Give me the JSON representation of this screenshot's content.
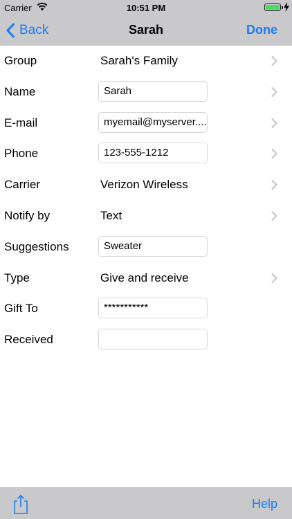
{
  "status_bar": {
    "carrier": "Carrier",
    "time": "10:51 PM"
  },
  "nav": {
    "back_label": "Back",
    "title": "Sarah",
    "done_label": "Done"
  },
  "rows": [
    {
      "label": "Group",
      "value": "Sarah's Family",
      "kind": "text",
      "chevron": true
    },
    {
      "label": "Name",
      "value": "Sarah",
      "kind": "field",
      "chevron": true
    },
    {
      "label": "E-mail",
      "value": "myemail@myserver....",
      "kind": "field",
      "chevron": true
    },
    {
      "label": "Phone",
      "value": "123-555-1212",
      "kind": "field",
      "chevron": true
    },
    {
      "label": "Carrier",
      "value": "Verizon Wireless",
      "kind": "text",
      "chevron": true
    },
    {
      "label": "Notify by",
      "value": "Text",
      "kind": "text",
      "chevron": true
    },
    {
      "label": "Suggestions",
      "value": "Sweater",
      "kind": "field",
      "chevron": false
    },
    {
      "label": "Type",
      "value": "Give and receive",
      "kind": "text",
      "chevron": true
    },
    {
      "label": "Gift To",
      "value": "***********",
      "kind": "field",
      "chevron": false
    },
    {
      "label": "Received",
      "value": "",
      "kind": "field",
      "chevron": false
    }
  ],
  "toolbar": {
    "help_label": "Help",
    "share_icon": "share-icon"
  },
  "colors": {
    "accent": "#1a7cf4",
    "bar_background": "#c9c9cb",
    "battery": "#4cd964"
  }
}
